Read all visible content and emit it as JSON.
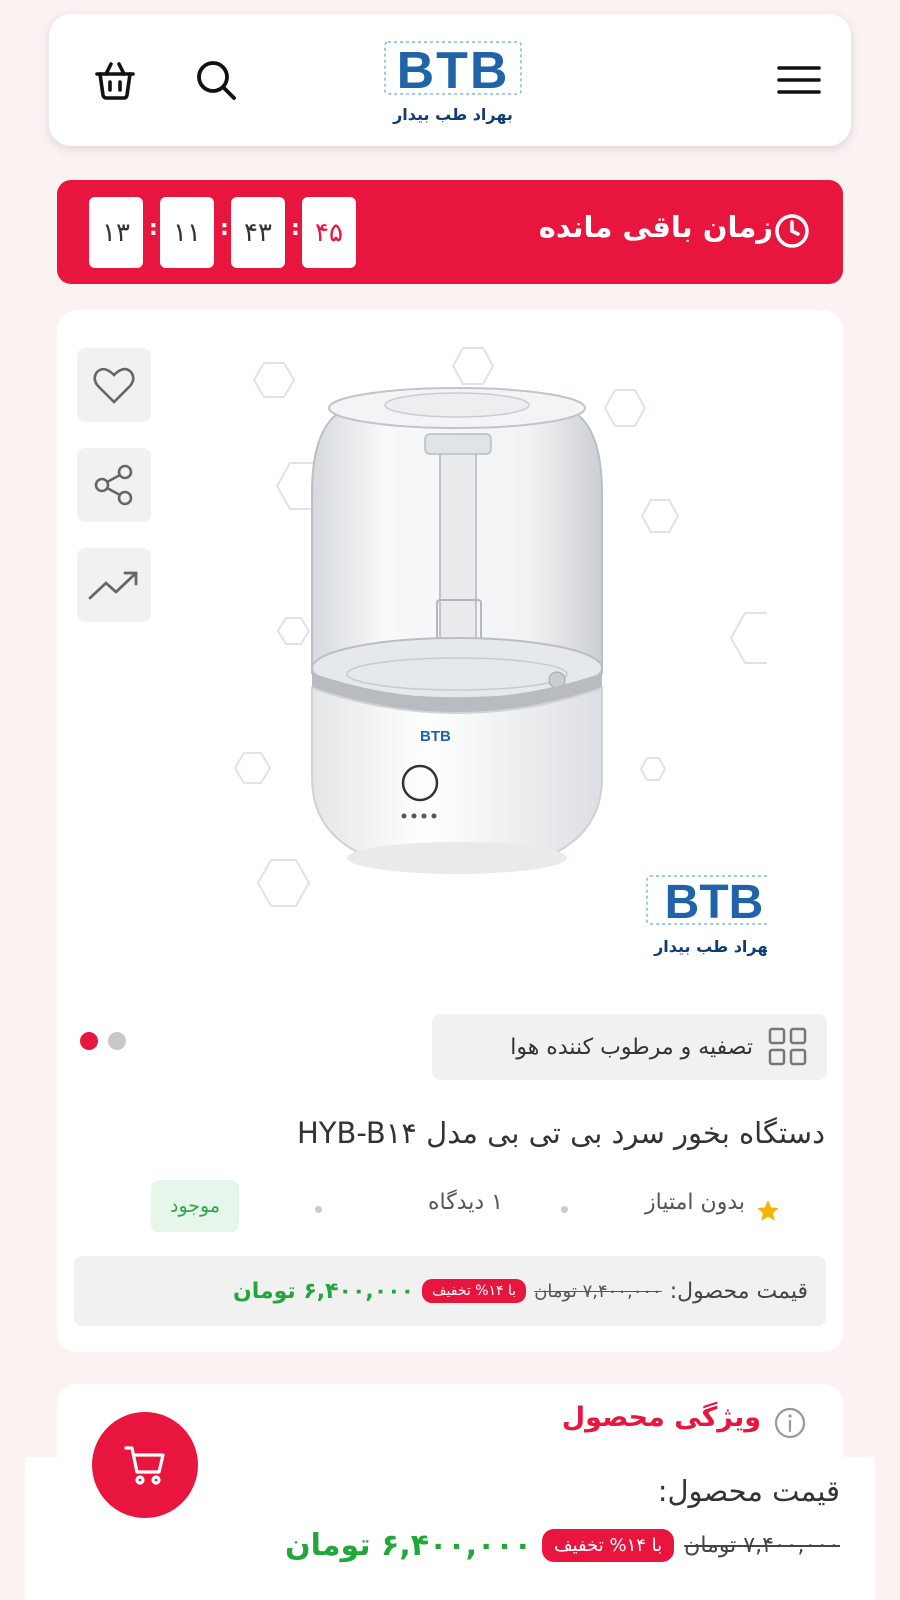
{
  "header": {
    "logo_letters": "BTB",
    "logo_tagline": "بهراد طب بیدار",
    "icons": [
      "basket-icon",
      "search-icon",
      "menu-icon"
    ]
  },
  "countdown": {
    "title": "زمان باقی مانده",
    "boxes": [
      "۱۳",
      "۱۱",
      "۴۳",
      "۴۵"
    ],
    "separator": ":"
  },
  "product": {
    "side_actions": [
      "heart-icon",
      "share-icon",
      "trend-icon"
    ],
    "image_brand": "BTB",
    "image_brand_tagline": "بهراد طب بیدار",
    "device_label": "BTB",
    "category": "تصفیه و مرطوب کننده هوا",
    "title": "دستگاه بخور سرد بی تی بی مدل HYB-B۱۴",
    "rating": "بدون امتیاز",
    "views": "۱ دیدگاه",
    "stock": "موجود",
    "price_label": "قیمت محصول:",
    "old_price": "۷,۴۰۰,۰۰۰ تومان",
    "discount": "با ۱۴% تخفیف",
    "new_price": "۶,۴۰۰,۰۰۰ تومان"
  },
  "features": {
    "title": "ویژگی محصول"
  },
  "bottom_bar": {
    "label": "قیمت محصول:",
    "old_price": "۷,۴۰۰,۰۰۰ تومان",
    "discount": "با ۱۴% تخفیف",
    "new_price": "۶,۴۰۰,۰۰۰ تومان"
  },
  "colors": {
    "accent": "#e8163e",
    "price_green": "#22a83a",
    "logo_blue": "#1f63a8",
    "logo_navy": "#123d73"
  }
}
